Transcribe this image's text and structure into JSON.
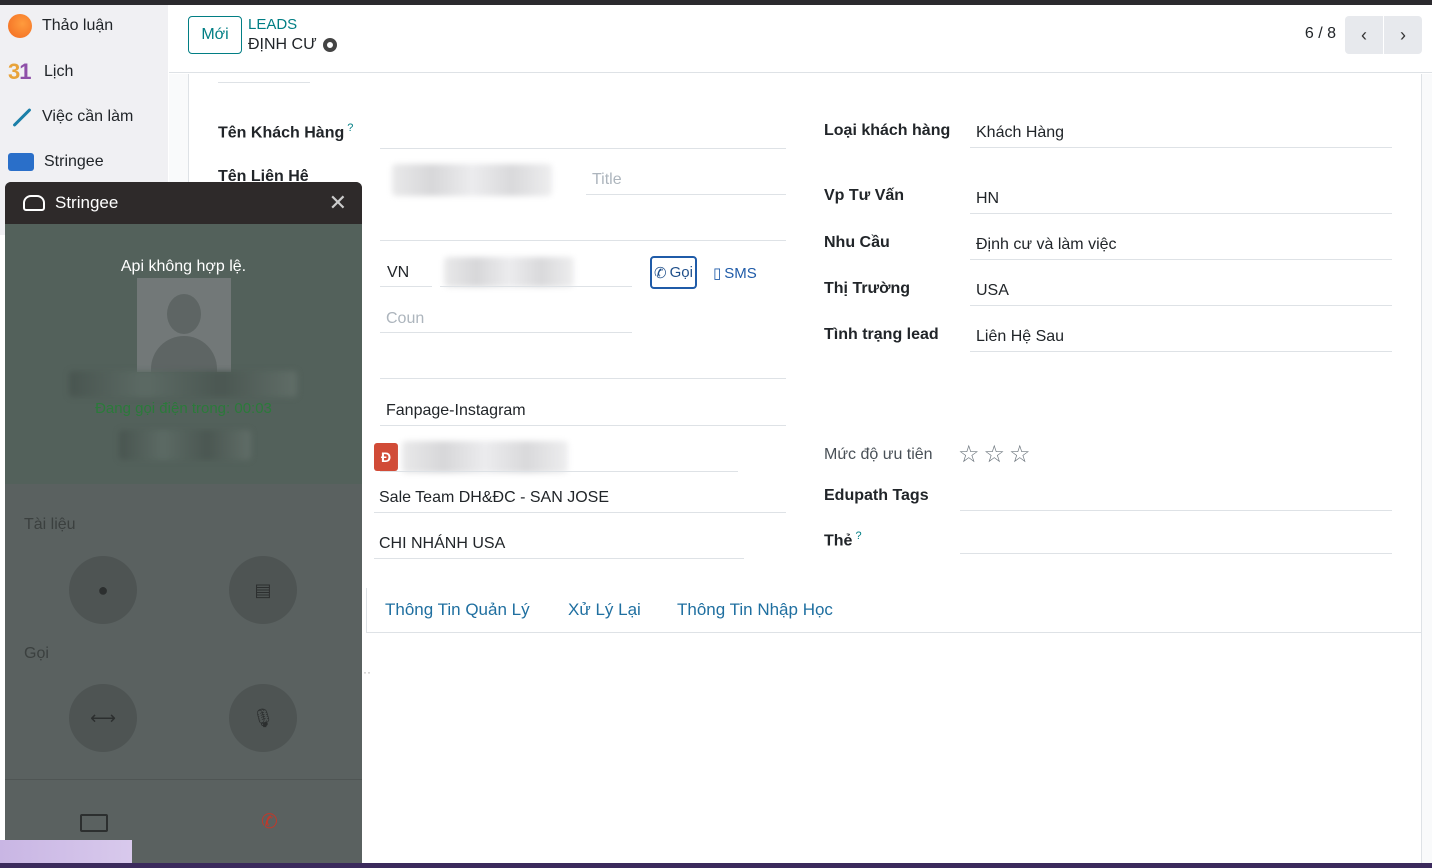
{
  "sidebar": {
    "items": [
      {
        "label": "Thảo luận",
        "icon": "discuss-icon"
      },
      {
        "label": "Lịch",
        "icon": "calendar-icon",
        "icon_text": "31"
      },
      {
        "label": "Việc cần làm",
        "icon": "todo-icon"
      },
      {
        "label": "Stringee",
        "icon": "stringee-icon"
      }
    ]
  },
  "header": {
    "new_button": "Mới",
    "breadcrumb_parent": "LEADS",
    "breadcrumb_current": "ĐỊNH CƯ",
    "pager": "6 / 8",
    "prev": "‹",
    "next": "›"
  },
  "form": {
    "left": {
      "customer_name_label": "Tên Khách Hàng",
      "contact_name_label": "Tên Liên Hệ",
      "title_placeholder": "Title",
      "phone_country": "VN",
      "call_button": "Gọi",
      "sms_button": "SMS",
      "country_placeholder": "Coun",
      "source": "Fanpage-Instagram",
      "salesperson_badge": "Đ",
      "sales_team": "Sale Team DH&ĐC - SAN JOSE",
      "branch": "CHI NHÁNH USA"
    },
    "right": {
      "customer_type_label": "Loại khách hàng",
      "customer_type": "Khách Hàng",
      "office_label": "Vp Tư Vấn",
      "office": "HN",
      "need_label": "Nhu Cầu",
      "need": "Định cư và làm việc",
      "market_label": "Thị Trường",
      "market": "USA",
      "status_label": "Tình trạng lead",
      "status": "Liên Hệ Sau",
      "priority_label": "Mức độ ưu tiên",
      "priority_stars": 0,
      "tags_label": "Edupath Tags",
      "the_label": "Thẻ"
    },
    "tabs": [
      "Thông Tin Quản Lý",
      "Xử Lý Lại",
      "Thông Tin Nhập Học"
    ]
  },
  "stringee_popup": {
    "title": "Stringee",
    "close": "✕",
    "message": "Api không hợp lệ.",
    "calling_status": "Đang gọi điện trong: 00:03",
    "docs_label": "Tài liệu",
    "call_label": "Gọi"
  },
  "colors": {
    "accent": "#017e84",
    "popup_header": "#2e2a2a",
    "popup_body": "#5a6160"
  }
}
